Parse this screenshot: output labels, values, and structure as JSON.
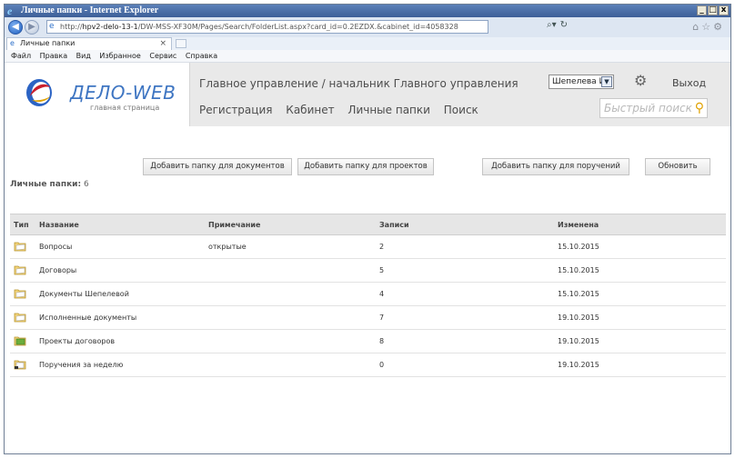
{
  "window": {
    "title": "Личные папки - Internet Explorer",
    "minimize": "_",
    "maximize": "□",
    "close": "x"
  },
  "address": {
    "url_prefix": "http://",
    "host": "hpv2-delo-13-1",
    "path": "/DW-MSS-XF30M/Pages/Search/FolderList.aspx?card_id=0.2EZDX.&cabinet_id=4058328"
  },
  "tab": {
    "label": "Личные папки",
    "close": "×"
  },
  "menu": [
    "Файл",
    "Правка",
    "Вид",
    "Избранное",
    "Сервис",
    "Справка"
  ],
  "app": {
    "logo": "ДЕЛО-WEB",
    "logo_sub": "главная страница",
    "org": "Главное управление / начальник Главного управления",
    "nav": [
      "Регистрация",
      "Кабинет",
      "Личные папки",
      "Поиск"
    ],
    "user": "Шепелева И.Г",
    "exit": "Выход",
    "search_placeholder": "Быстрый поиск"
  },
  "toolbar": {
    "buttons": [
      "Добавить папку для документов",
      "Добавить папку для проектов",
      "Добавить папку для поручений",
      "Обновить"
    ],
    "count_label": "Личные папки:",
    "count": "6"
  },
  "table": {
    "columns": [
      "Тип",
      "Название",
      "Примечание",
      "Записи",
      "Изменена"
    ],
    "rows": [
      {
        "icon": "folder-documents-icon",
        "name": "Вопросы",
        "note": "открытые",
        "records": "2",
        "changed": "15.10.2015"
      },
      {
        "icon": "folder-documents-icon",
        "name": "Договоры",
        "note": "",
        "records": "5",
        "changed": "15.10.2015"
      },
      {
        "icon": "folder-documents-icon",
        "name": "Документы Шепелевой",
        "note": "",
        "records": "4",
        "changed": "15.10.2015"
      },
      {
        "icon": "folder-documents-icon",
        "name": "Исполненные документы",
        "note": "",
        "records": "7",
        "changed": "19.10.2015"
      },
      {
        "icon": "folder-projects-icon",
        "name": "Проекты договоров",
        "note": "",
        "records": "8",
        "changed": "19.10.2015"
      },
      {
        "icon": "folder-assignments-icon",
        "name": "Поручения за неделю",
        "note": "",
        "records": "0",
        "changed": "19.10.2015"
      }
    ]
  },
  "colors": {
    "logo_blue": "#3e75c2",
    "header_bg": "#e9e9e9",
    "folder_yellow": "#f2d37a",
    "projects_green": "#6cae3c"
  }
}
